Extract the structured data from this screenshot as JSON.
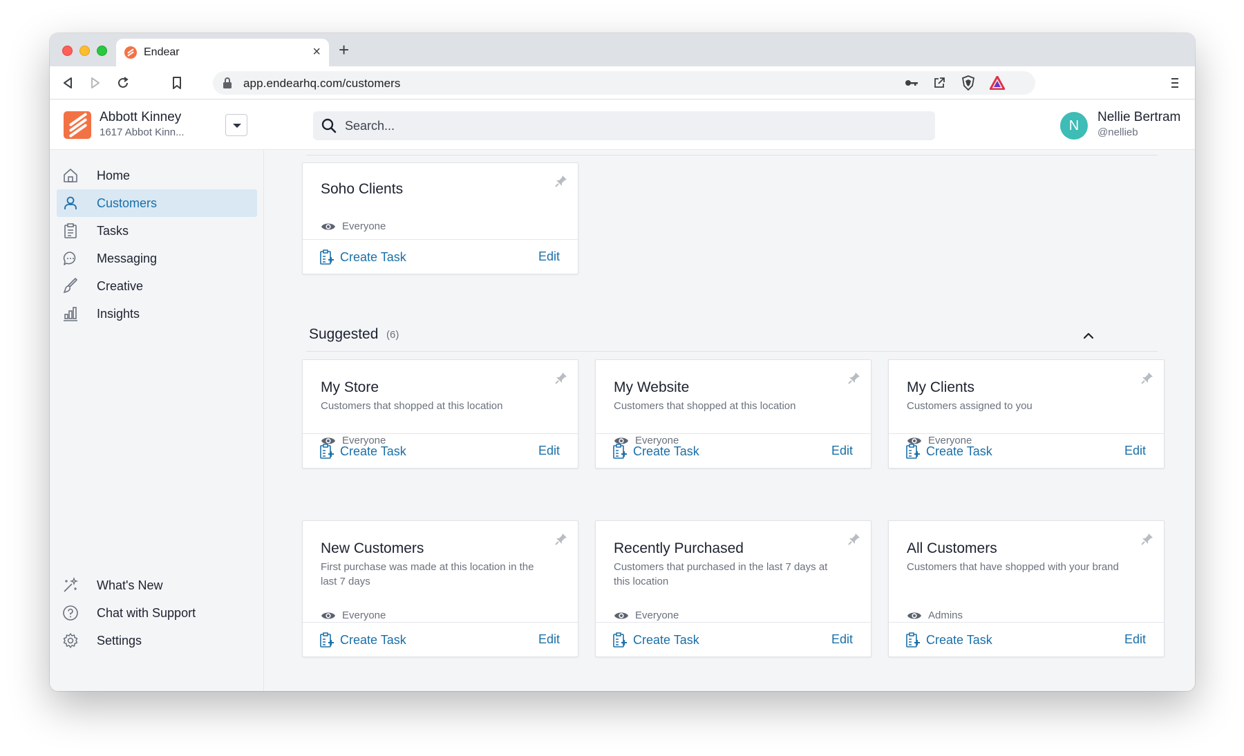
{
  "browser": {
    "tab_title": "Endear",
    "tab_close": "×",
    "new_tab": "+",
    "url": "app.endearhq.com/customers"
  },
  "header": {
    "store_name": "Abbott Kinney",
    "store_address": "1617 Abbot Kinn...",
    "search_placeholder": "Search...",
    "user_initial": "N",
    "user_name": "Nellie Bertram",
    "user_handle": "@nellieb",
    "avatar_color": "#3ebcb6",
    "brand_color": "#f37245"
  },
  "sidebar": {
    "items": [
      {
        "label": "Home",
        "icon": "home-icon"
      },
      {
        "label": "Customers",
        "icon": "user-icon",
        "active": true
      },
      {
        "label": "Tasks",
        "icon": "clipboard-icon"
      },
      {
        "label": "Messaging",
        "icon": "chat-bubble-icon"
      },
      {
        "label": "Creative",
        "icon": "brush-icon"
      },
      {
        "label": "Insights",
        "icon": "bar-chart-icon"
      }
    ],
    "bottom_items": [
      {
        "label": "What's New",
        "icon": "sparkles-icon"
      },
      {
        "label": "Chat with Support",
        "icon": "help-circle-icon"
      },
      {
        "label": "Settings",
        "icon": "gear-icon"
      }
    ]
  },
  "pinned_card": {
    "title": "Soho Clients",
    "visibility": "Everyone",
    "create_task": "Create Task",
    "edit": "Edit"
  },
  "suggested": {
    "title": "Suggested",
    "count": "(6)",
    "cards": [
      {
        "title": "My Store",
        "description": "Customers that shopped at this location",
        "visibility": "Everyone",
        "create_task": "Create Task",
        "edit": "Edit"
      },
      {
        "title": "My Website",
        "description": "Customers that shopped at this location",
        "visibility": "Everyone",
        "create_task": "Create Task",
        "edit": "Edit"
      },
      {
        "title": "My Clients",
        "description": "Customers assigned to you",
        "visibility": "Everyone",
        "create_task": "Create Task",
        "edit": "Edit"
      },
      {
        "title": "New Customers",
        "description": "First purchase was made at this location in the last 7 days",
        "visibility": "Everyone",
        "create_task": "Create Task",
        "edit": "Edit"
      },
      {
        "title": "Recently Purchased",
        "description": "Customers that purchased in the last 7 days at this location",
        "visibility": "Everyone",
        "create_task": "Create Task",
        "edit": "Edit"
      },
      {
        "title": "All Customers",
        "description": "Customers that have shopped with your brand",
        "visibility": "Admins",
        "create_task": "Create Task",
        "edit": "Edit"
      }
    ]
  }
}
